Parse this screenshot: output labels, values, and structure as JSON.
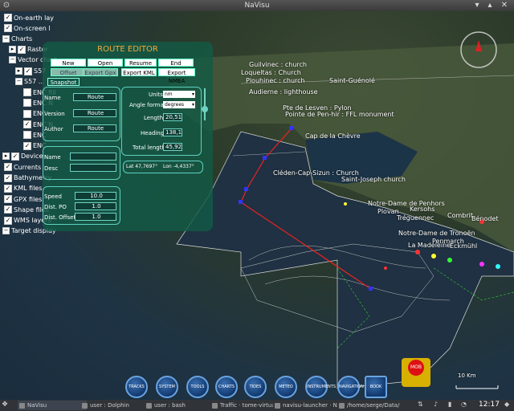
{
  "window": {
    "title": "NaVisu"
  },
  "tree": {
    "items": [
      {
        "label": "On-earth lay",
        "expand": "",
        "checked": true,
        "indent": 0
      },
      {
        "label": "On-screen l",
        "expand": "",
        "checked": true,
        "indent": 0
      },
      {
        "label": "Charts",
        "expand": "−",
        "checked": null,
        "indent": 0
      },
      {
        "label": "Raster",
        "expand": "▸",
        "checked": true,
        "indent": 1
      },
      {
        "label": "Vector chart",
        "expand": "−",
        "checked": null,
        "indent": 1
      },
      {
        "label": "S57",
        "expand": "▸",
        "checked": true,
        "indent": 2
      },
      {
        "label": "S57 ...",
        "expand": "−",
        "checked": null,
        "indent": 2
      },
      {
        "label": "ENC fill",
        "expand": "",
        "checked": false,
        "indent": 3
      },
      {
        "label": "ENC N",
        "expand": "",
        "checked": false,
        "indent": 3
      },
      {
        "label": "ENC",
        "expand": "",
        "checked": false,
        "indent": 3
      },
      {
        "label": "ENC N",
        "expand": "",
        "checked": true,
        "indent": 3
      },
      {
        "label": "ENC",
        "expand": "",
        "checked": false,
        "indent": 3
      },
      {
        "label": "ENC",
        "expand": "",
        "checked": true,
        "indent": 3
      },
      {
        "label": "Devices",
        "expand": "▸",
        "checked": true,
        "indent": 0
      },
      {
        "label": "Currents",
        "expand": "",
        "checked": true,
        "indent": 0
      },
      {
        "label": "Bathymetry",
        "expand": "",
        "checked": true,
        "indent": 0
      },
      {
        "label": "KML files",
        "expand": "",
        "checked": true,
        "indent": 0
      },
      {
        "label": "GPX files",
        "expand": "",
        "checked": true,
        "indent": 0
      },
      {
        "label": "Shape files",
        "expand": "",
        "checked": true,
        "indent": 0
      },
      {
        "label": "WMS layers",
        "expand": "",
        "checked": true,
        "indent": 0
      },
      {
        "label": "Target display",
        "expand": "−",
        "checked": null,
        "indent": 0
      }
    ]
  },
  "route_editor": {
    "title": "ROUTE EDITOR",
    "buttons_row1": [
      "New",
      "Open",
      "Resume",
      "End"
    ],
    "buttons_row2": [
      "Offset",
      "Export Gpx",
      "Export KML",
      "Export NMEA"
    ],
    "snapshot": "Snapshot",
    "fields": [
      {
        "label": "Name",
        "button": "Route"
      },
      {
        "label": "Version",
        "button": "Route"
      },
      {
        "label": "Author",
        "button": "Route"
      }
    ],
    "units_label": "Units",
    "units_value": "nm",
    "angle_label": "Angle format",
    "angle_value": "degrees",
    "length_label": "Length",
    "length_value": "20,51",
    "heading_label": "Heading",
    "heading_value": "138,1",
    "total_label": "Total length",
    "total_value": "45,92",
    "lat_label": "Lat 47,7697°",
    "lon_label": "Lon -4,4337°",
    "wp_name_label": "Name",
    "wp_desc_label": "Desc",
    "speed_label": "Speed",
    "speed_value": "10.0",
    "distpo_label": "Dist. PO",
    "distpo_value": "1.0",
    "distoffset_label": "Dist. Offset",
    "distoffset_value": "1.0"
  },
  "map_labels": {
    "l1": "Guilvinec : church",
    "l2": "Loqueltas : Church",
    "l3": "Plouhinec : church",
    "l4": "Saint-Guénolé",
    "l5": "Audierne : lighthouse",
    "l6": "Pte de Lesven : Pylon",
    "l7": "Pointe de Pen-hir : FFL monument",
    "l8": "Cap de la Chèvre",
    "l9": "Cléden-Cap-Sizun : Church",
    "l10": "Saint-Joseph church",
    "l11": "Notre-Dame de Penhors",
    "l12": "Plovan",
    "l13": "Kersohs",
    "l14": "Tréguennec",
    "l15": "Combrit",
    "l16": "Bénodet",
    "l17": "Notre-Dame de Tronoën",
    "l18": "La Madeleine",
    "l19": "Penmarch",
    "l20": "Eckmühl"
  },
  "toolbar": {
    "items": [
      "TRACKS",
      "SYSTEM I/O",
      "TOOLS",
      "CHARTS",
      "TIDES STREAMS",
      "METEO",
      "INSTRUMENTS",
      "NAVIGATION",
      "BOOK"
    ],
    "mob": "MOB",
    "scale": "10 Km"
  },
  "taskbar": {
    "items": [
      "NaVisu",
      "user : Dolphin",
      "user : bash",
      "Traffic · tome-virtual",
      "navisu-launcher · NetB",
      "/home/serge/Data/..."
    ],
    "clock": "12:17"
  }
}
